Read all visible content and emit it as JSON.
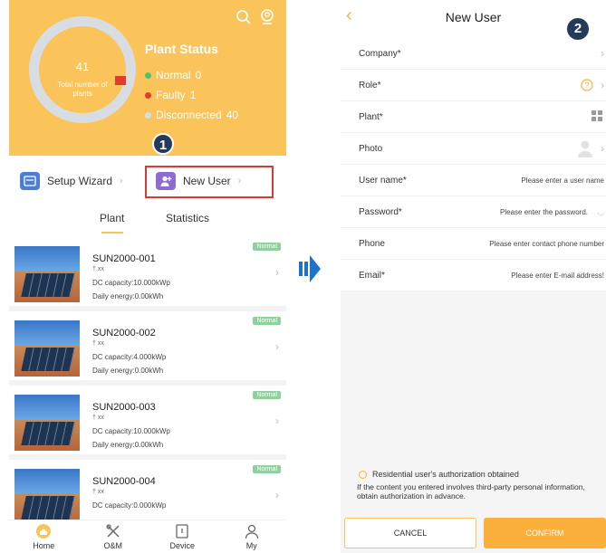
{
  "left": {
    "donut": {
      "total": "41",
      "total_label": "Total number of plants"
    },
    "status": {
      "title": "Plant Status",
      "normal_label": "Normal",
      "normal_count": "0",
      "faulty_label": "Faulty",
      "faulty_count": "1",
      "disconnected_label": "Disconnected",
      "disconnected_count": "40"
    },
    "step_badge": "1",
    "quick": {
      "setup_wizard": "Setup Wizard",
      "new_user": "New User"
    },
    "tabs": {
      "plant": "Plant",
      "statistics": "Statistics"
    },
    "plants": [
      {
        "name": "SUN2000-001",
        "loc": "xx",
        "cap": "DC capacity:10.000kWp",
        "day": "Daily energy:0.00kWh",
        "badge": "Normal"
      },
      {
        "name": "SUN2000-002",
        "loc": "xx",
        "cap": "DC capacity:4.000kWp",
        "day": "Daily energy:0.00kWh",
        "badge": "Normal"
      },
      {
        "name": "SUN2000-003",
        "loc": "xx",
        "cap": "DC capacity:10.000kWp",
        "day": "Daily energy:0.00kWh",
        "badge": "Normal"
      },
      {
        "name": "SUN2000-004",
        "loc": "xx",
        "cap": "DC capacity:0.000kWp",
        "day": "",
        "badge": "Normal"
      }
    ],
    "nav": {
      "home": "Home",
      "om": "O&M",
      "device": "Device",
      "my": "My"
    }
  },
  "right": {
    "title": "New User",
    "step_badge": "2",
    "fields": {
      "company": "Company*",
      "role": "Role*",
      "plant": "Plant*",
      "photo": "Photo",
      "username": "User name*",
      "username_ph": "Please enter a user name",
      "password": "Password*",
      "password_ph": "Please enter the password.",
      "phone": "Phone",
      "phone_ph": "Please enter contact phone number",
      "email": "Email*",
      "email_ph": "Please enter E-mail address!"
    },
    "auth_label": "Residential user's authorization obtained",
    "auth_note": "If the content you entered involves third-party personal information, obtain authorization in advance.",
    "cancel": "CANCEL",
    "confirm": "CONFIRM"
  },
  "colors": {
    "accent": "#fbc45a",
    "accent_dark": "#fbb03b",
    "highlight": "#d93a35",
    "step_badge": "#233a5a",
    "arrow": "#1e73c8"
  }
}
